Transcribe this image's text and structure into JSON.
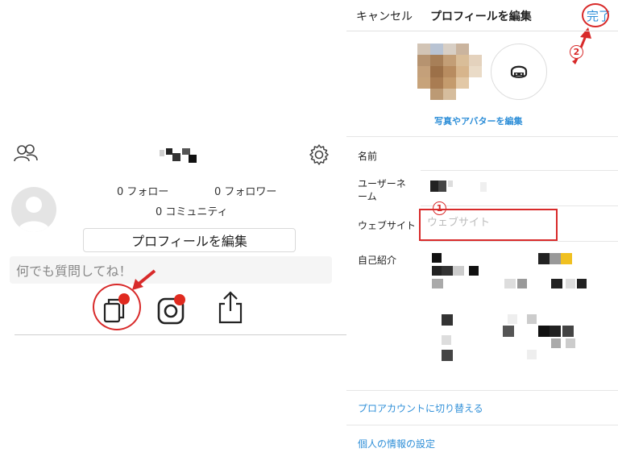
{
  "profile": {
    "stats": {
      "follow": "0 フォロー",
      "follower": "0 フォロワー",
      "community": "0 コミュニティ"
    },
    "edit_button": "プロフィールを編集",
    "ask_placeholder": "何でも質問してね！",
    "icons": [
      "people-icon",
      "gear-icon",
      "copy-link-icon",
      "instagram-icon",
      "share-icon"
    ],
    "highlight_color": "#d82a2a"
  },
  "editor": {
    "cancel": "キャンセル",
    "title": "プロフィールを編集",
    "done": "完了",
    "edit_photo": "写真やアバターを編集",
    "fields": {
      "name_label": "名前",
      "username_label": "ユーザーネーム",
      "website_label": "ウェブサイト",
      "website_placeholder": "ウェブサイト",
      "bio_label": "自己紹介"
    },
    "pro_account": "プロアカウントに切り替える",
    "privacy": "個人の情報の設定",
    "annotations": {
      "step1": "1",
      "step2": "2"
    },
    "link_color": "#2f8fd8"
  }
}
